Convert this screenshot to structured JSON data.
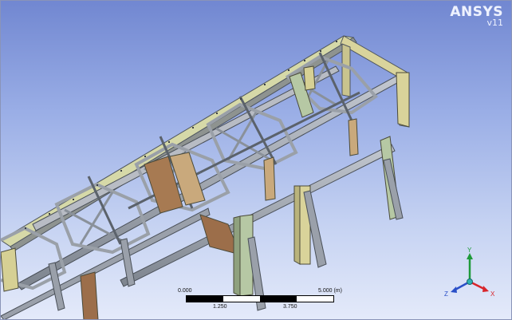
{
  "logo": {
    "brand": "ANSYS",
    "version": "v11"
  },
  "scale": {
    "top_labels": [
      "0.000",
      "5.000 (m)"
    ],
    "bottom_labels": [
      "1.250",
      "3.750"
    ]
  },
  "triad": {
    "x_label": "X",
    "y_label": "Y",
    "z_label": "Z"
  },
  "colors": {
    "steel_gray": "#a8aeb8",
    "steel_dark": "#5f6670",
    "member_yellow": "#d9d39a",
    "member_green": "#b6c8a4",
    "member_brown": "#a77a52",
    "member_tan": "#c9a97c",
    "axis_x": "#d8252b",
    "axis_y": "#1f9a3a",
    "axis_z": "#2a4fc8"
  }
}
